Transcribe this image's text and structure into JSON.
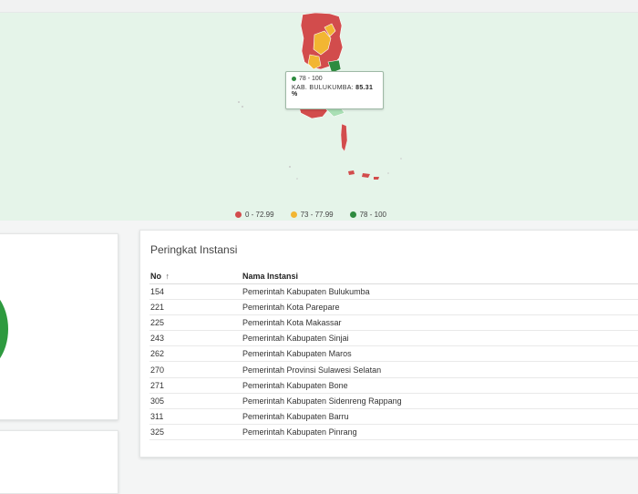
{
  "map": {
    "tooltip": {
      "range_label": "78 - 100",
      "region": "KAB. BULUKUMBA:",
      "value": "85.31 %"
    },
    "legend": [
      {
        "label": "0 - 72.99",
        "color": "#d24c4c"
      },
      {
        "label": "73 - 77.99",
        "color": "#f2b632"
      },
      {
        "label": "78 - 100",
        "color": "#2e8b3f"
      }
    ]
  },
  "ranking": {
    "title": "Peringkat Instansi",
    "col_no": "No",
    "col_no_sort": "↑",
    "col_name": "Nama Instansi",
    "rows": [
      {
        "no": "154",
        "name": "Pemerintah Kabupaten Bulukumba"
      },
      {
        "no": "221",
        "name": "Pemerintah Kota Parepare"
      },
      {
        "no": "225",
        "name": "Pemerintah Kota Makassar"
      },
      {
        "no": "243",
        "name": "Pemerintah Kabupaten Sinjai"
      },
      {
        "no": "262",
        "name": "Pemerintah Kabupaten Maros"
      },
      {
        "no": "270",
        "name": "Pemerintah Provinsi Sulawesi Selatan"
      },
      {
        "no": "271",
        "name": "Pemerintah Kabupaten Bone"
      },
      {
        "no": "305",
        "name": "Pemerintah Kabupaten Sidenreng Rappang"
      },
      {
        "no": "311",
        "name": "Pemerintah Kabupaten Barru"
      },
      {
        "no": "325",
        "name": "Pemerintah Kabupaten Pinrang"
      }
    ]
  }
}
